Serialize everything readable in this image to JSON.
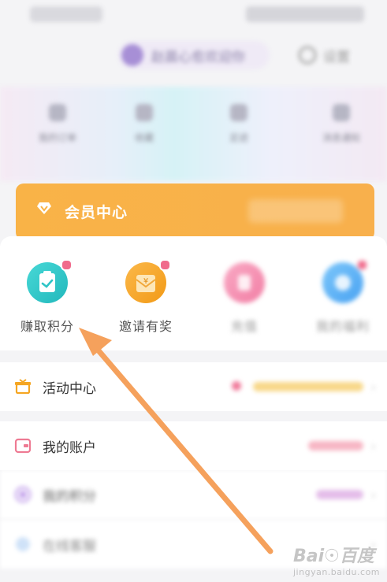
{
  "header": {
    "user_name": "赵晨心愈欢迎你",
    "settings_label": "设置"
  },
  "quick_links": [
    {
      "label": "我的订单",
      "icon": "order-icon"
    },
    {
      "label": "收藏",
      "icon": "favorite-icon"
    },
    {
      "label": "足迹",
      "icon": "history-icon"
    },
    {
      "label": "消息通知",
      "icon": "message-icon"
    }
  ],
  "vip_card": {
    "title": "会员中心",
    "icon": "diamond-icon",
    "color": "#F9B347"
  },
  "features": [
    {
      "label": "赚取积分",
      "icon": "checkin-icon",
      "color": "#2EC4C6",
      "has_badge": true
    },
    {
      "label": "邀请有奖",
      "icon": "gift-envelope-icon",
      "color": "#F6A623",
      "has_badge": true
    },
    {
      "label": "充值",
      "icon": "recharge-icon",
      "color": "#F48FB1",
      "has_badge": false
    },
    {
      "label": "我的福利",
      "icon": "welfare-icon",
      "color": "#5AB2F6",
      "has_badge": true
    }
  ],
  "menu": [
    {
      "label": "活动中心",
      "icon": "gift-box-icon",
      "color": "#F5A623"
    },
    {
      "label": "我的账户",
      "icon": "wallet-icon",
      "color": "#EE7A93"
    },
    {
      "label": "我的积分",
      "icon": "points-icon",
      "color": "#B58BE6"
    },
    {
      "label": "在线客服",
      "icon": "service-icon",
      "color": "#7DB4F0"
    }
  ],
  "watermark": {
    "brand": "Bai☉百度",
    "url": "jingyan.baidu.com"
  }
}
